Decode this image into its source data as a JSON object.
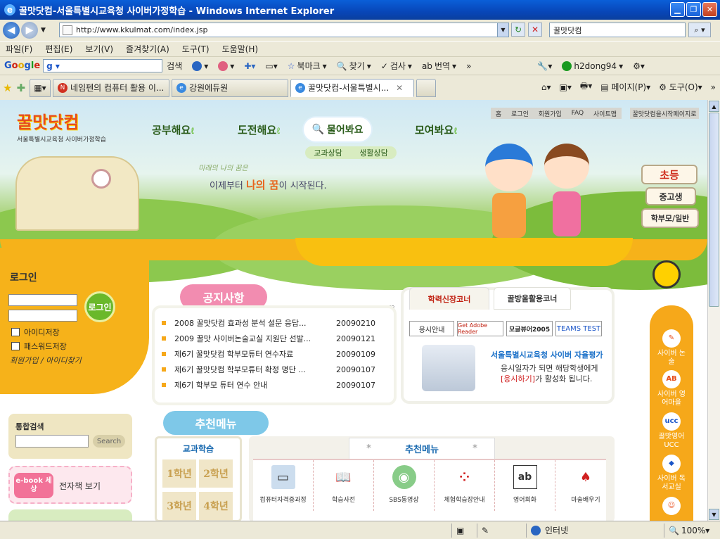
{
  "window": {
    "title": "꿀맛닷컴-서울특별시교육청 사이버가정학습 - Windows Internet Explorer"
  },
  "address": {
    "url": "http://www.kkulmat.com/index.jsp",
    "search_value": "꿀맛닷컴"
  },
  "menu": [
    "파일(F)",
    "편집(E)",
    "보기(V)",
    "즐겨찾기(A)",
    "도구(T)",
    "도움말(H)"
  ],
  "google_bar": {
    "logo": "Google",
    "search_label": "검색",
    "bookmark": "북마크",
    "find": "찾기",
    "spell": "검사",
    "translate": "번역",
    "user": "h2dong94"
  },
  "tabs": [
    {
      "label": "네임펜의 컴퓨터 활용 이..."
    },
    {
      "label": "강원에듀원"
    },
    {
      "label": "꿀맛닷컴-서울특별시..."
    }
  ],
  "tab_tools": {
    "page": "페이지(P)",
    "tools": "도구(O)"
  },
  "status": {
    "zone": "인터넷",
    "zoom": "100%"
  },
  "site": {
    "logo_sub": "서울특별시교육청 사이버가정학습",
    "nav": [
      "공부해요",
      "도전해요",
      "물어봐요",
      "모여봐요"
    ],
    "subnav": [
      "교과상담",
      "생활상담"
    ],
    "util_links": [
      "홈",
      "로그인",
      "회원가입",
      "FAQ",
      "사이트맵"
    ],
    "startpage": "꿀맛닷컴을시작페이지로",
    "tagline_small": "미래의 나의 꿈은",
    "tagline_pre": "이제부터 ",
    "tagline_hl": "나의 꿈",
    "tagline_post": "이 시작된다.",
    "grades": [
      "초등",
      "중고생",
      "학부모/일반"
    ],
    "login_title": "로그인",
    "login_button": "로그인",
    "save_id": "아이디저장",
    "save_pw": "패스워드저장",
    "join_links": "회원가입 / 아이디찾기",
    "search_label": "통합검색",
    "search_button": "Search",
    "ebook_tag": "e-book 세상",
    "ebook_label": "전자책 보기",
    "notice_title": "공지사항",
    "more": "more",
    "notices": [
      {
        "title": "2008 꿀맛닷컴 효과성 분석 설문 응답...",
        "date": "20090210"
      },
      {
        "title": "2009 꿀맛 사이버논술교실 지원단 선발...",
        "date": "20090121"
      },
      {
        "title": "제6기 꿀맛닷컴 학부모튜터 연수자료",
        "date": "20090109"
      },
      {
        "title": "제6기 꿀맛닷컴 학부모튜터 확정 명단 ...",
        "date": "20090107"
      },
      {
        "title": "제6기 학부모 튜터 연수 안내",
        "date": "20090107"
      }
    ],
    "corner_tabs": [
      "학력신장코너",
      "꿀방울활용코너"
    ],
    "corner_buttons": [
      "응시안내",
      "Get Adobe Reader",
      "모글뷰어2005",
      "TEAMS TEST"
    ],
    "corner_title": "서울특별시교육청 사이버 자율평가",
    "corner_text1": "응시일자가 되면 해당학생에게",
    "corner_text_red": "[응시하기]",
    "corner_text2": "가 활성화 됩니다.",
    "rec_title": "추천메뉴",
    "subject_title": "교과학습",
    "subject_grades": [
      "1학년",
      "2학년",
      "3학년",
      "4학년"
    ],
    "rec_tab": "추천메뉴",
    "rec_items": [
      "컴퓨터자격증과정",
      "학습사전",
      "SBS동영상",
      "체험학습장안내",
      "영어회화",
      "마술배우기"
    ],
    "side_items": [
      "사이버 논술",
      "사이버 영어마을",
      "꿀맛영어 UCC",
      "사이버 독서교실"
    ]
  },
  "colors": {
    "honey": "#f6b21a",
    "accent_blue": "#1a6ab0",
    "pink": "#f28cb0"
  }
}
